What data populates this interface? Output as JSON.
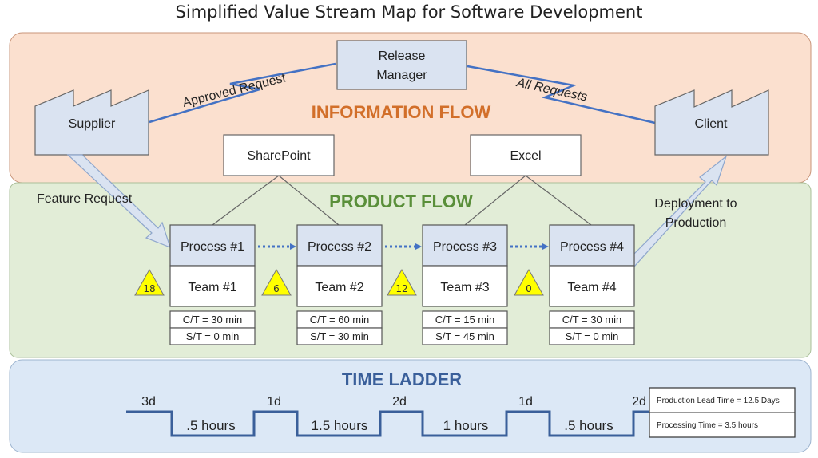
{
  "title": "Simplified Value Stream Map for Software Development",
  "colors": {
    "info_bg": "#fbe0cf",
    "info_border": "#c9957a",
    "info_title": "#d26f2a",
    "product_bg": "#e2edd7",
    "product_border": "#a9bf98",
    "product_title": "#5a8f3a",
    "ladder_bg": "#dce8f6",
    "ladder_border": "#9db4cf",
    "ladder_title": "#3a5f9a",
    "box_fill": "#dae3f1",
    "line_blue": "#4472c4",
    "inventory_fill": "#ffff00"
  },
  "information_flow": {
    "title": "INFORMATION FLOW",
    "release_manager": [
      "Release",
      "Manager"
    ],
    "supplier": "Supplier",
    "client": "Client",
    "approved_request": "Approved Request",
    "all_requests": "All Requests",
    "sharepoint": "SharePoint",
    "excel": "Excel"
  },
  "product_flow": {
    "title": "PRODUCT FLOW",
    "feature_request": "Feature Request",
    "deployment": [
      "Deployment to",
      "Production"
    ],
    "processes": [
      {
        "name": "Process #1",
        "team": "Team #1",
        "ct": "C/T = 30 min",
        "st": "S/T = 0 min",
        "inventory": "18"
      },
      {
        "name": "Process #2",
        "team": "Team #2",
        "ct": "C/T = 60 min",
        "st": "S/T = 30 min",
        "inventory": "6"
      },
      {
        "name": "Process #3",
        "team": "Team #3",
        "ct": "C/T = 15 min",
        "st": "S/T  = 45 min",
        "inventory": "12"
      },
      {
        "name": "Process #4",
        "team": "Team #4",
        "ct": "C/T = 30 min",
        "st": "S/T = 0 min",
        "inventory": "0"
      }
    ]
  },
  "time_ladder": {
    "title": "TIME LADDER",
    "wait_times": [
      "3d",
      "1d",
      "2d",
      "1d",
      "2d"
    ],
    "process_times": [
      ".5 hours",
      "1.5 hours",
      "1 hours",
      ".5 hours"
    ],
    "summary": {
      "lead_time": "Production  Lead Time = 12.5 Days",
      "processing_time": "Processing  Time = 3.5 hours"
    }
  }
}
